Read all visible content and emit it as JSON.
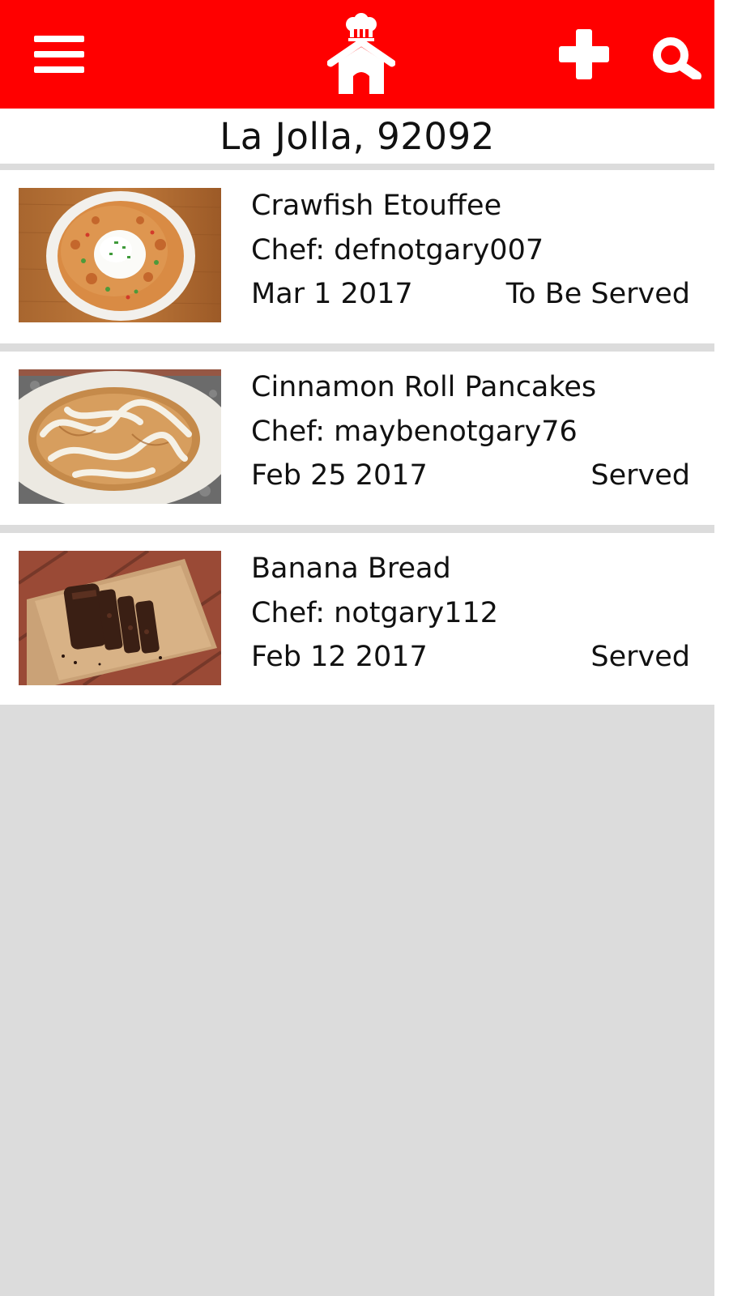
{
  "colors": {
    "app_bar": "#ff0000",
    "icon": "#ffffff",
    "background": "#dcdcdc",
    "card": "#ffffff"
  },
  "header": {
    "menu_icon": "hamburger-menu-icon",
    "logo_icon": "chef-house-icon",
    "add_icon": "plus-icon",
    "search_icon": "search-icon"
  },
  "location": {
    "label": "La Jolla, 92092"
  },
  "meals": [
    {
      "title": "Crawfish Etouffee",
      "chef": "Chef: defnotgary007",
      "date": "Mar 1 2017",
      "status": "To Be Served",
      "image_icon": "crawfish-etouffee-photo"
    },
    {
      "title": "Cinnamon Roll Pancakes",
      "chef": "Chef: maybenotgary76",
      "date": "Feb 25 2017",
      "status": "Served",
      "image_icon": "cinnamon-roll-pancakes-photo"
    },
    {
      "title": "Banana Bread",
      "chef": "Chef: notgary112",
      "date": "Feb 12 2017",
      "status": "Served",
      "image_icon": "banana-bread-photo"
    }
  ]
}
